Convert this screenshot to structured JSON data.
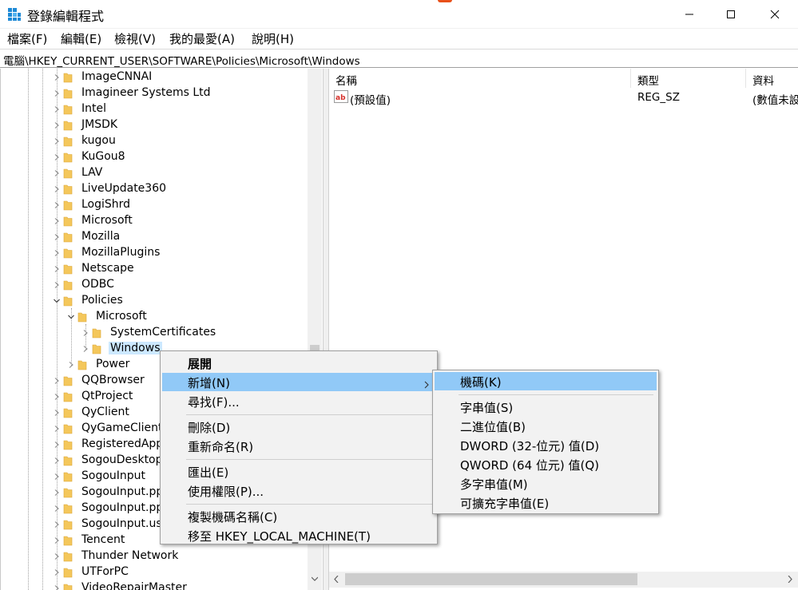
{
  "window": {
    "title": "登錄編輯程式",
    "controls": {
      "minimize": "minimize-icon",
      "maximize": "maximize-icon",
      "close": "close-icon"
    }
  },
  "menubar": [
    "檔案(F)",
    "編輯(E)",
    "檢視(V)",
    "我的最愛(A)",
    "說明(H)"
  ],
  "address": "電腦\\HKEY_CURRENT_USER\\SOFTWARE\\Policies\\Microsoft\\Windows",
  "tree": [
    {
      "label": "ImageCNNAI",
      "depth": 0,
      "expanded": false
    },
    {
      "label": "Imagineer Systems Ltd",
      "depth": 0,
      "expanded": false
    },
    {
      "label": "Intel",
      "depth": 0,
      "expanded": false
    },
    {
      "label": "JMSDK",
      "depth": 0,
      "expanded": false
    },
    {
      "label": "kugou",
      "depth": 0,
      "expanded": false
    },
    {
      "label": "KuGou8",
      "depth": 0,
      "expanded": false
    },
    {
      "label": "LAV",
      "depth": 0,
      "expanded": false
    },
    {
      "label": "LiveUpdate360",
      "depth": 0,
      "expanded": false
    },
    {
      "label": "LogiShrd",
      "depth": 0,
      "expanded": false
    },
    {
      "label": "Microsoft",
      "depth": 0,
      "expanded": false
    },
    {
      "label": "Mozilla",
      "depth": 0,
      "expanded": false
    },
    {
      "label": "MozillaPlugins",
      "depth": 0,
      "expanded": false
    },
    {
      "label": "Netscape",
      "depth": 0,
      "expanded": false
    },
    {
      "label": "ODBC",
      "depth": 0,
      "expanded": false
    },
    {
      "label": "Policies",
      "depth": 0,
      "expanded": true
    },
    {
      "label": "Microsoft",
      "depth": 1,
      "expanded": true
    },
    {
      "label": "SystemCertificates",
      "depth": 2,
      "expanded": false
    },
    {
      "label": "Windows",
      "depth": 2,
      "expanded": false,
      "selected": true
    },
    {
      "label": "Power",
      "depth": 1,
      "expanded": false
    },
    {
      "label": "QQBrowser",
      "depth": 0,
      "expanded": false
    },
    {
      "label": "QtProject",
      "depth": 0,
      "expanded": false
    },
    {
      "label": "QyClient",
      "depth": 0,
      "expanded": false
    },
    {
      "label": "QyGameClient",
      "depth": 0,
      "expanded": false
    },
    {
      "label": "RegisteredApp",
      "depth": 0,
      "expanded": false
    },
    {
      "label": "SogouDesktop",
      "depth": 0,
      "expanded": false
    },
    {
      "label": "SogouInput",
      "depth": 0,
      "expanded": false
    },
    {
      "label": "SogouInput.pp",
      "depth": 0,
      "expanded": false
    },
    {
      "label": "SogouInput.pp",
      "depth": 0,
      "expanded": false
    },
    {
      "label": "SogouInput.us",
      "depth": 0,
      "expanded": false
    },
    {
      "label": "Tencent",
      "depth": 0,
      "expanded": false
    },
    {
      "label": "Thunder Network",
      "depth": 0,
      "expanded": false
    },
    {
      "label": "UTForPC",
      "depth": 0,
      "expanded": false
    },
    {
      "label": "VideoRepairMaster",
      "depth": 0,
      "expanded": false
    }
  ],
  "list": {
    "columns": [
      "名稱",
      "類型",
      "資料"
    ],
    "rows": [
      {
        "name": "(預設值)",
        "type": "REG_SZ",
        "data": "(數值未設"
      }
    ]
  },
  "context_menu": {
    "items": [
      {
        "label": "展開",
        "bold": true
      },
      {
        "label": "新增(N)",
        "submenu": true,
        "highlighted": true
      },
      {
        "label": "尋找(F)..."
      },
      {
        "separator": true
      },
      {
        "label": "刪除(D)"
      },
      {
        "label": "重新命名(R)"
      },
      {
        "separator": true
      },
      {
        "label": "匯出(E)"
      },
      {
        "label": "使用權限(P)..."
      },
      {
        "separator": true
      },
      {
        "label": "複製機碼名稱(C)"
      },
      {
        "label": "移至 HKEY_LOCAL_MACHINE(T)"
      }
    ]
  },
  "submenu": {
    "items": [
      {
        "label": "機碼(K)",
        "highlighted": true
      },
      {
        "separator": true
      },
      {
        "label": "字串值(S)"
      },
      {
        "label": "二進位值(B)"
      },
      {
        "label": "DWORD (32-位元) 值(D)"
      },
      {
        "label": "QWORD (64 位元) 值(Q)"
      },
      {
        "label": "多字串值(M)"
      },
      {
        "label": "可擴充字串值(E)"
      }
    ]
  },
  "colors": {
    "selection": "#cce8ff",
    "menu_highlight": "#91c9f7",
    "folder": "#f4c75b",
    "accent": "#e8501a"
  }
}
